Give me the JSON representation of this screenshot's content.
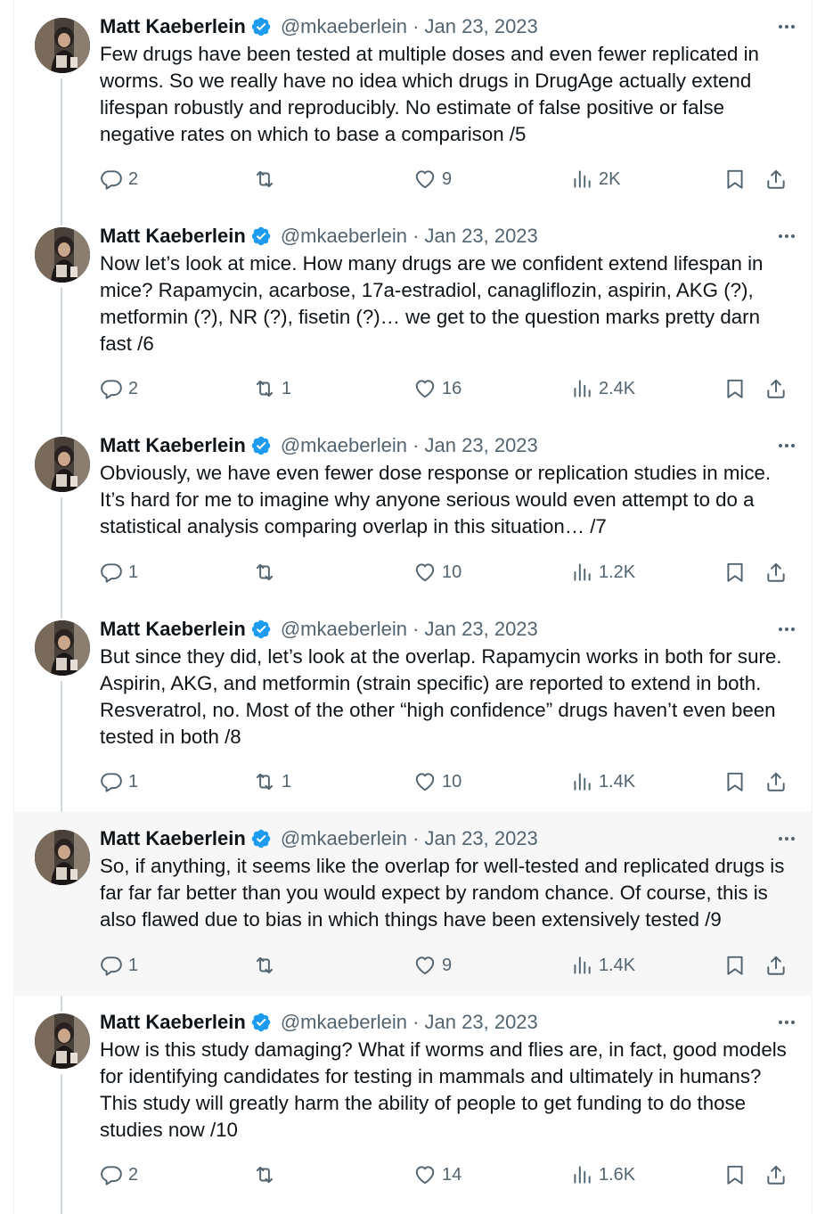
{
  "tweets": [
    {
      "name": "Matt Kaeberlein",
      "handle_date": "@mkaeberlein · Jan 23, 2023",
      "text": "Few drugs have been tested at multiple doses and even fewer replicated in worms. So we really have no idea which drugs in DrugAge actually extend lifespan robustly and reproducibly. No estimate of false positive or false negative rates on which to base a comparison /5",
      "replies": "2",
      "retweets": "",
      "likes": "9",
      "views": "2K"
    },
    {
      "name": "Matt Kaeberlein",
      "handle_date": "@mkaeberlein · Jan 23, 2023",
      "text": "Now let’s look at mice. How many drugs are we confident extend lifespan in mice? Rapamycin, acarbose, 17a-estradiol, canagliflozin, aspirin, AKG (?), metformin (?), NR (?), fisetin (?)… we get to the question marks pretty darn fast /6",
      "replies": "2",
      "retweets": "1",
      "likes": "16",
      "views": "2.4K"
    },
    {
      "name": "Matt Kaeberlein",
      "handle_date": "@mkaeberlein · Jan 23, 2023",
      "text": "Obviously, we have even fewer dose response or replication studies in mice. It’s hard for me to imagine why anyone serious would even attempt to do a statistical analysis comparing overlap in this situation… /7",
      "replies": "1",
      "retweets": "",
      "likes": "10",
      "views": "1.2K"
    },
    {
      "name": "Matt Kaeberlein",
      "handle_date": "@mkaeberlein · Jan 23, 2023",
      "text": "But since they did, let’s look at the overlap.  Rapamycin works in both for sure. Aspirin, AKG, and metformin (strain specific) are reported to extend in both. Resveratrol, no. Most of the other “high confidence” drugs haven’t even been tested in both /8",
      "replies": "1",
      "retweets": "1",
      "likes": "10",
      "views": "1.4K"
    },
    {
      "name": "Matt Kaeberlein",
      "handle_date": "@mkaeberlein · Jan 23, 2023",
      "text": "So, if anything, it seems like the overlap for well-tested and replicated drugs is far far far better than you would expect by random chance.  Of course, this is also flawed due to bias in which things have been extensively tested /9",
      "replies": "1",
      "retweets": "",
      "likes": "9",
      "views": "1.4K"
    },
    {
      "name": "Matt Kaeberlein",
      "handle_date": "@mkaeberlein · Jan 23, 2023",
      "text": "How is this study damaging? What if worms and flies are, in fact, good models for identifying candidates for testing in mammals and ultimately in humans? This study will greatly harm the ability of people to get funding to do those studies now /10",
      "replies": "2",
      "retweets": "",
      "likes": "14",
      "views": "1.6K"
    }
  ]
}
